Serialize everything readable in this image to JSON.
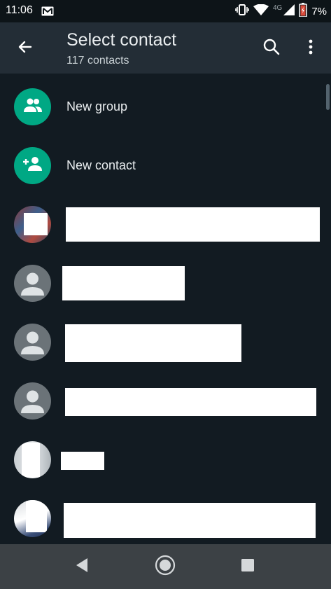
{
  "status_bar": {
    "time": "11:06",
    "network": "4G",
    "battery": "7%",
    "icons": [
      "gmail-icon",
      "vibrate-icon",
      "wifi-icon",
      "signal-icon",
      "battery-icon"
    ]
  },
  "app_bar": {
    "title": "Select contact",
    "subtitle": "117 contacts",
    "icons": [
      "back-arrow-icon",
      "search-icon",
      "more-vert-icon"
    ]
  },
  "actions": [
    {
      "label": "New group",
      "icon": "group-icon"
    },
    {
      "label": "New contact",
      "icon": "person-add-icon"
    }
  ],
  "nav_bar": {
    "icons": [
      "back-triangle-icon",
      "home-circle-icon",
      "recents-square-icon"
    ]
  },
  "colors": {
    "background": "#121b22",
    "app_bar": "#232d36",
    "status_bar": "#0d1418",
    "accent": "#00a884",
    "nav_bar": "#3c4145",
    "avatar_gray": "#6b7378"
  }
}
